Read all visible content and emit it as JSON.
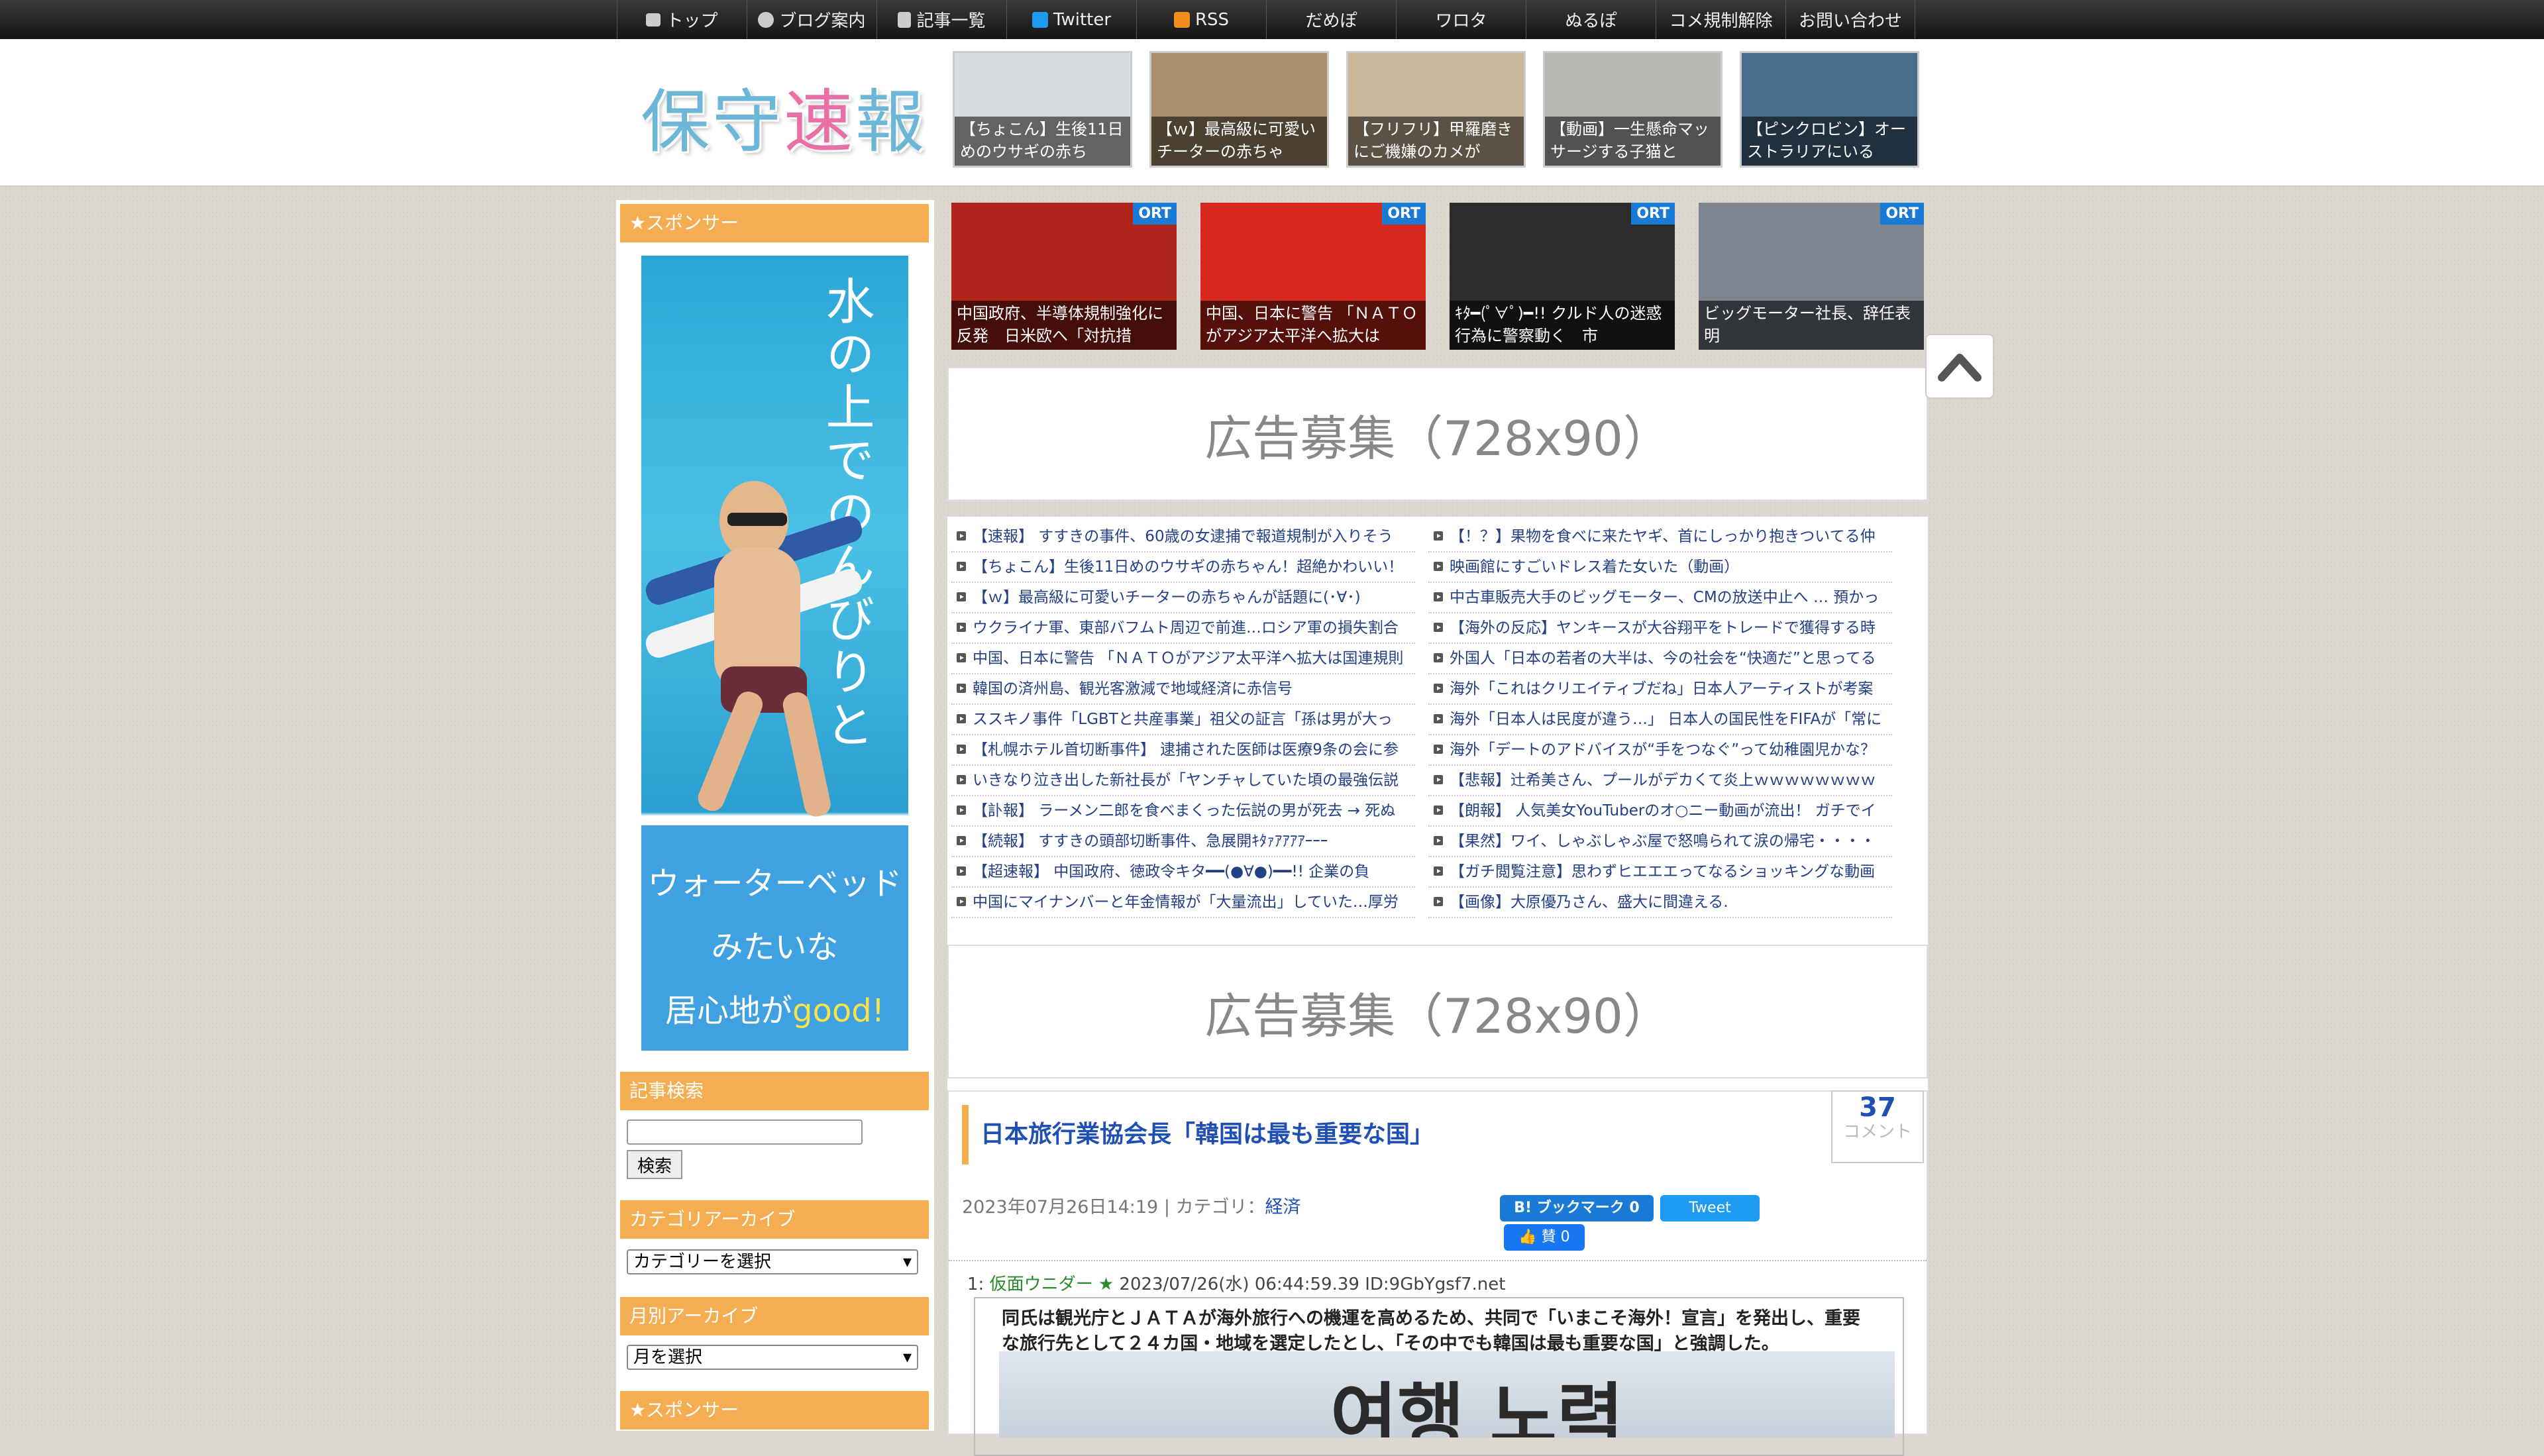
{
  "nav": {
    "items": [
      {
        "label": "トップ",
        "icon": "home-icon"
      },
      {
        "label": "ブログ案内",
        "icon": "info-icon"
      },
      {
        "label": "記事一覧",
        "icon": "list-icon"
      },
      {
        "label": "Twitter",
        "icon": "twitter-icon"
      },
      {
        "label": "RSS",
        "icon": "rss-icon"
      },
      {
        "label": "だめぽ",
        "icon": ""
      },
      {
        "label": "ワロタ",
        "icon": ""
      },
      {
        "label": "ぬるぽ",
        "icon": ""
      },
      {
        "label": "コメ規制解除",
        "icon": ""
      },
      {
        "label": "お問い合わせ",
        "icon": ""
      }
    ]
  },
  "logo": {
    "part1": "保守",
    "part2": "速",
    "part3": "報"
  },
  "header_thumbs": [
    {
      "caption": "【ちょこん】生後11日めのウサギの赤ち",
      "color": "#d8dbe0"
    },
    {
      "caption": "【ｗ】最高級に可愛いチーターの赤ちゃ",
      "color": "#a98f6a"
    },
    {
      "caption": "【フリフリ】甲羅磨きにご機嫌のカメが",
      "color": "#c9b79a"
    },
    {
      "caption": "【動画】一生懸命マッサージする子猫と",
      "color": "#b9b7b4"
    },
    {
      "caption": "【ピンクロビン】オーストラリアにいる",
      "color": "#4a6b8a"
    }
  ],
  "sidebar": {
    "sponsor_title": "★スポンサー",
    "banner_vertical_text": "水の上でのんびりと",
    "banner_line1": "ウォーターベッド",
    "banner_line2": "みたいな",
    "banner_line3a": "居心地が",
    "banner_line3b": "good!",
    "search_title": "記事検索",
    "search_button": "検索",
    "category_title": "カテゴリアーカイブ",
    "category_select": "カテゴリーを選択",
    "monthly_title": "月別アーカイブ",
    "monthly_select": "月を選択",
    "sponsor_title2": "★スポンサー"
  },
  "news_cards": [
    {
      "caption": "中国政府、半導体規制強化に反発　日米欧へ「対抗措",
      "badge": "ORT",
      "color": "#b0241c"
    },
    {
      "caption": "中国、日本に警告 「ＮＡＴＯがアジア太平洋へ拡大は",
      "badge": "ORT",
      "color": "#d6281e"
    },
    {
      "caption": "ｷﾀ━(ﾟ∀ﾟ)━!! クルド人の迷惑行為に警察動く　市",
      "badge": "ORT",
      "color": "#2c2c2c"
    },
    {
      "caption": "ビッグモーター社長、辞任表明",
      "badge": "ORT",
      "color": "#7d8591"
    }
  ],
  "ad_text": "広告募集（728x90）",
  "links_left": [
    "【速報】 すすきの事件、60歳の女逮捕で報道規制が入りそう",
    "【ちょこん】生後11日めのウサギの赤ちゃん！超絶かわいい！",
    "【ｗ】最高級に可愛いチーターの赤ちゃんが話題に(･∀･)",
    "ウクライナ軍、東部バフムト周辺で前進…ロシア軍の損失割合",
    "中国、日本に警告 「ＮＡＴＯがアジア太平洋へ拡大は国連規則",
    "韓国の済州島、観光客激減で地域経済に赤信号",
    "ススキノ事件「LGBTと共産事業」祖父の証言「孫は男が大っ",
    "【札幌ホテル首切断事件】 逮捕された医師は医療9条の会に参",
    "いきなり泣き出した新社長が「ヤンチャしていた頃の最強伝説",
    "【訃報】 ラーメン二郎を食べまくった伝説の男が死去 → 死ぬ",
    "【続報】 すすきの頭部切断事件、急展開ｷﾀｧｱｱｱｱｰｰｰ",
    "【超速報】 中国政府、徳政令キタ━━(●∀●)━━!! 企業の負",
    "中国にマイナンバーと年金情報が「大量流出」していた…厚労"
  ],
  "links_right": [
    "【！？】果物を食べに来たヤギ、首にしっかり抱きついてる仲",
    "映画館にすごいドレス着た女いた（動画）",
    "中古車販売大手のビッグモーター、CMの放送中止へ … 預かっ",
    "【海外の反応】ヤンキースが大谷翔平をトレードで獲得する時",
    "外国人「日本の若者の大半は、今の社会を“快適だ”と思ってる",
    "海外「これはクリエイティブだね」日本人アーティストが考案",
    "海外「日本人は民度が違う…」 日本人の国民性をFIFAが「常に",
    "海外「デートのアドバイスが“手をつなぐ”って幼稚園児かな？",
    "【悲報】辻希美さん、プールがデカくて炎上ｗｗｗｗｗｗｗｗ",
    "【朗報】 人気美女YouTuberのオ○ニー動画が流出！ ガチでイ",
    "【果然】ワイ、しゃぶしゃぶ屋で怒鳴られて涙の帰宅・・・・",
    "【ガチ閲覧注意】思わずヒエエエってなるショッキングな動画",
    "【画像】大原優乃さん、盛大に間違える."
  ],
  "article": {
    "title": "日本旅行業協会長「韓国は最も重要な国」",
    "comment_count": "37",
    "comment_label": "コメント",
    "date": "2023年07月26日14:19",
    "category_label": "カテゴリ：",
    "category": "経済",
    "hatena": "B! ブックマーク  0",
    "tweet": "Tweet",
    "like": "👍 賛 0",
    "res_num": "1:",
    "res_name": "仮面ウニダー ★",
    "res_meta": "2023/07/26(水) 06:44:59.39 ID:9GbYgsf7.net",
    "res_body": "同氏は観光庁とＪＡＴＡが海外旅行への機運を高めるため、共同で「いまこそ海外！宣言」を発出し、重要な旅行先として２４カ国・地域を選定したとし、「その中でも韓国は最も重要な国」と強調した。",
    "res_image_text": "여행 노력"
  }
}
